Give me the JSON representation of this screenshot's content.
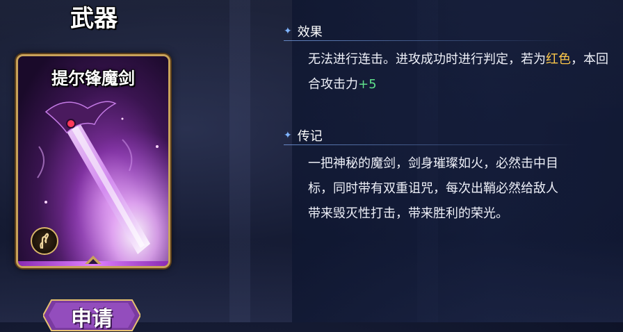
{
  "page": {
    "title": "武器"
  },
  "card": {
    "name": "提尔锋魔剑",
    "badge_icon": "crossed-fingers-icon",
    "art": "purple-demonic-sword"
  },
  "apply_button": {
    "label": "申请"
  },
  "effect": {
    "header": "效果",
    "text_part1": "无法进行连击。进攻成功时进行判定，若为",
    "highlight": "红色",
    "text_part2": "，本回合攻击力",
    "bonus": "+5"
  },
  "lore": {
    "header": "传记",
    "line1": "一把神秘的魔剑，剑身璀璨如火，必然击中目",
    "line2": "标，同时带有双重诅咒，每次出鞘必然给敌人",
    "line3": "带来毁灭性打击，带来胜利的荣光。"
  },
  "colors": {
    "accent_blue": "#7fb4ff",
    "highlight_red_word": "#ffc94a",
    "bonus_green": "#5fe08a",
    "card_frame_gold": "#c9a35a"
  }
}
